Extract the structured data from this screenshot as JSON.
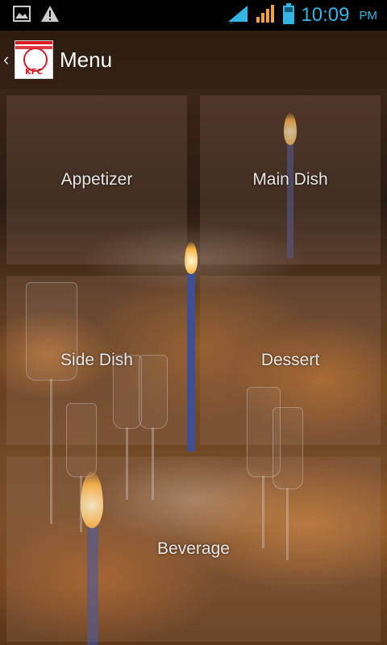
{
  "status_bar": {
    "time": "10:09",
    "ampm": "PM",
    "icons": [
      "image-icon",
      "warning-icon",
      "wifi-signal-icon",
      "cell-signal-icon",
      "battery-icon"
    ]
  },
  "action_bar": {
    "title": "Menu",
    "logo_text": "KFC"
  },
  "menu": {
    "appetizer": "Appetizer",
    "main_dish": "Main Dish",
    "side_dish": "Side Dish",
    "dessert": "Dessert",
    "beverage": "Beverage"
  },
  "colors": {
    "accent": "#33b5e5",
    "brand_red": "#d81b23"
  }
}
